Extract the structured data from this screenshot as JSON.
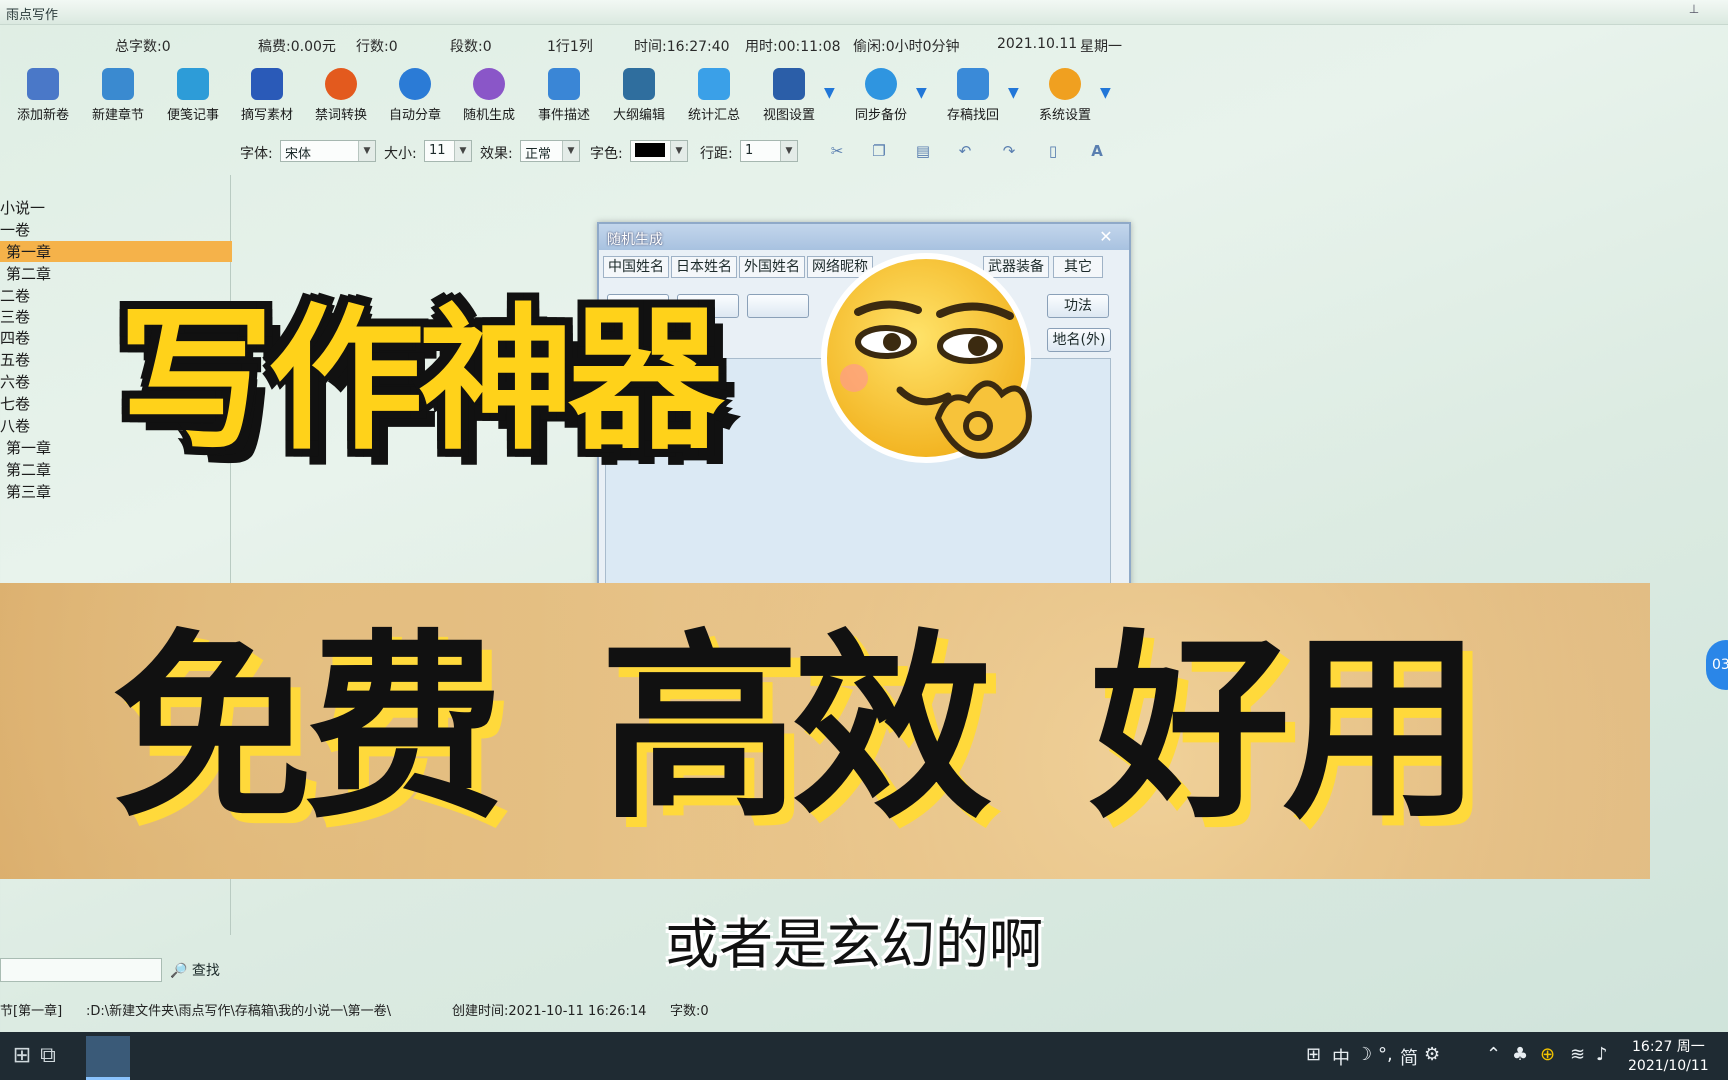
{
  "app": {
    "title": "雨点写作"
  },
  "stats": {
    "total_words": "总字数:0",
    "fee": "稿费:0.00元",
    "lines": "行数:0",
    "paragraphs": "段数:0",
    "cursor": "1行1列",
    "time": "时间:16:27:40",
    "used": "用时:00:11:08",
    "idle": "偷闲:0小时0分钟",
    "date": "2021.10.11",
    "weekday": "星期一"
  },
  "toolbar": {
    "items": [
      {
        "label": "添加新卷",
        "icon": "add-volume-icon",
        "color": "#4a78c8"
      },
      {
        "label": "新建章节",
        "icon": "new-chapter-icon",
        "color": "#3a8ad0"
      },
      {
        "label": "便笺记事",
        "icon": "notes-icon",
        "color": "#2d9cd8"
      },
      {
        "label": "摘写素材",
        "icon": "material-book-icon",
        "color": "#2a5ab8"
      },
      {
        "label": "禁词转换",
        "icon": "undo-arrow-icon",
        "color": "#e35a1e"
      },
      {
        "label": "自动分章",
        "icon": "sync-arrows-icon",
        "color": "#2b7bd6"
      },
      {
        "label": "随机生成",
        "icon": "people-icon",
        "color": "#8a56c8"
      },
      {
        "label": "事件描述",
        "icon": "window-icon",
        "color": "#3a86d6"
      },
      {
        "label": "大纲编辑",
        "icon": "outline-book-icon",
        "color": "#2f6e9e"
      },
      {
        "label": "统计汇总",
        "icon": "font-plus-icon",
        "color": "#3aa0e8"
      },
      {
        "label": "视图设置",
        "icon": "view-window-icon",
        "color": "#2b5ea8"
      },
      {
        "label": "同步备份",
        "icon": "cloud-icon",
        "color": "#2f95e0"
      },
      {
        "label": "存稿找回",
        "icon": "recover-icon",
        "color": "#3a8ad8"
      },
      {
        "label": "系统设置",
        "icon": "gear-icon",
        "color": "#f0a020"
      }
    ]
  },
  "format_bar": {
    "font_label": "字体:",
    "font_value": "宋体",
    "size_label": "大小:",
    "size_value": "11",
    "effect_label": "效果:",
    "effect_value": "正常",
    "color_label": "字色:",
    "spacing_label": "行距:",
    "spacing_value": "1",
    "tools": [
      "scissors-icon",
      "copy-icon",
      "paste-icon",
      "undo-icon",
      "redo-icon",
      "page-icon",
      "font-a-icon"
    ]
  },
  "tree": {
    "nodes": [
      {
        "label": "小说一"
      },
      {
        "label": "一卷"
      },
      {
        "label": "第一章",
        "selected": true
      },
      {
        "label": "第二章"
      },
      {
        "label": "二卷"
      },
      {
        "label": "三卷"
      },
      {
        "label": "四卷"
      },
      {
        "label": "五卷"
      },
      {
        "label": "六卷"
      },
      {
        "label": "七卷"
      },
      {
        "label": "八卷"
      },
      {
        "label": "第一章"
      },
      {
        "label": "第二章"
      },
      {
        "label": "第三章"
      }
    ]
  },
  "dialog": {
    "title": "随机生成",
    "tabs": [
      "中国姓名",
      "日本姓名",
      "外国姓名",
      "网络昵称",
      "武器装备",
      "其它"
    ],
    "buttons": [
      "功法",
      "地名(外)"
    ]
  },
  "overlay": {
    "headline": "写作神器",
    "banner_words": [
      "免费",
      "高效",
      "好用"
    ],
    "subtitle": "或者是玄幻的啊",
    "side_bubble": "03"
  },
  "search": {
    "button": "查找"
  },
  "status": {
    "node": "节[第一章]",
    "path": ":D:\\新建文件夹\\雨点写作\\存稿箱\\我的小说一\\第一卷\\",
    "created": "创建时间:2021-10-11 16:26:14",
    "words": "字数:0"
  },
  "taskbar": {
    "tray": [
      "中",
      "简"
    ],
    "clock_time": "16:27 周一",
    "clock_date": "2021/10/11"
  },
  "colors": {
    "accent": "#2277d8",
    "selection": "#f5b24a",
    "headline": "#ffd21a"
  }
}
